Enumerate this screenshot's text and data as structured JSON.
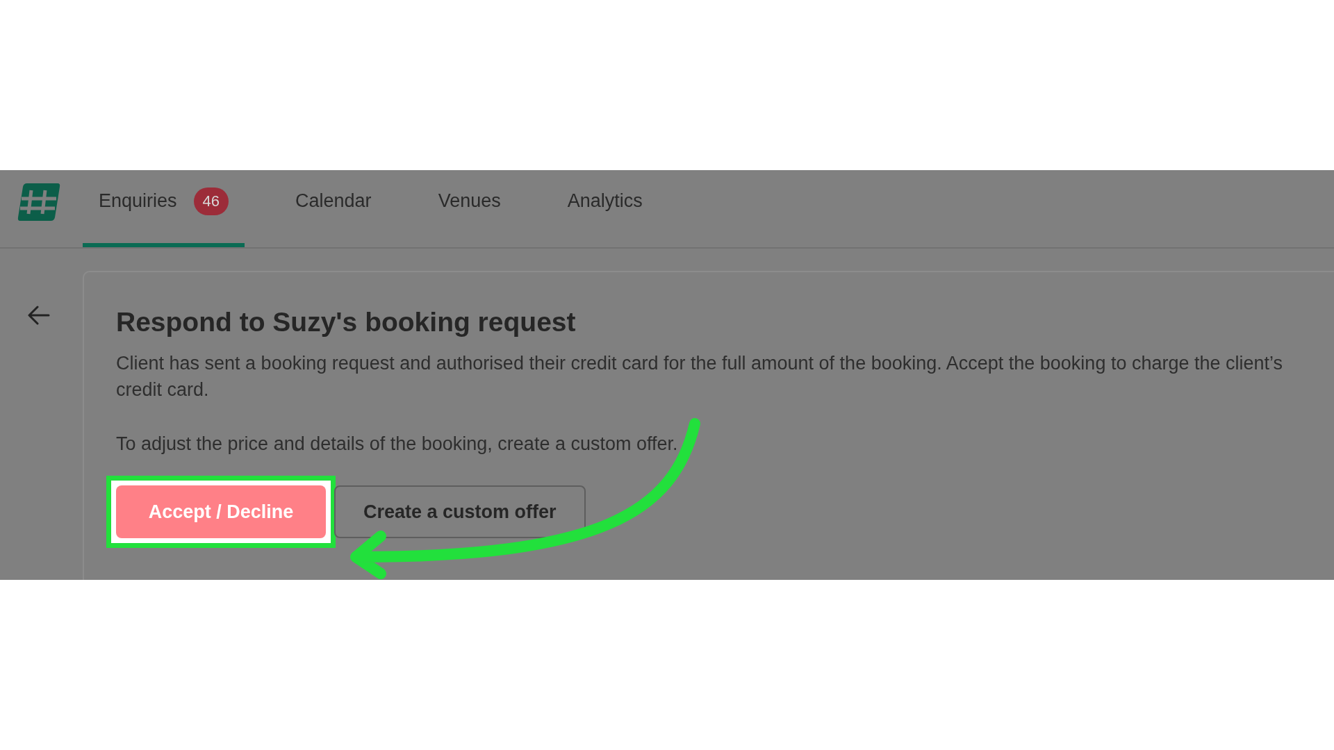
{
  "nav": {
    "tabs": [
      {
        "label": "Enquiries",
        "badge": "46",
        "selected": true
      },
      {
        "label": "Calendar",
        "selected": false
      },
      {
        "label": "Venues",
        "selected": false
      },
      {
        "label": "Analytics",
        "selected": false
      }
    ]
  },
  "prompt": {
    "title": "Respond to Suzy's booking request",
    "paragraphs": [
      "Client has sent a booking request and authorised their credit card for the full amount of the booking. Accept the booking to charge the client’s credit card.",
      "To adjust the price and details of the booking, create a custom offer."
    ],
    "buttons": [
      {
        "label": "Accept / Decline",
        "kind": "primary",
        "highlighted": true
      },
      {
        "label": "Create a custom offer",
        "kind": "secondary",
        "highlighted": false
      }
    ]
  }
}
